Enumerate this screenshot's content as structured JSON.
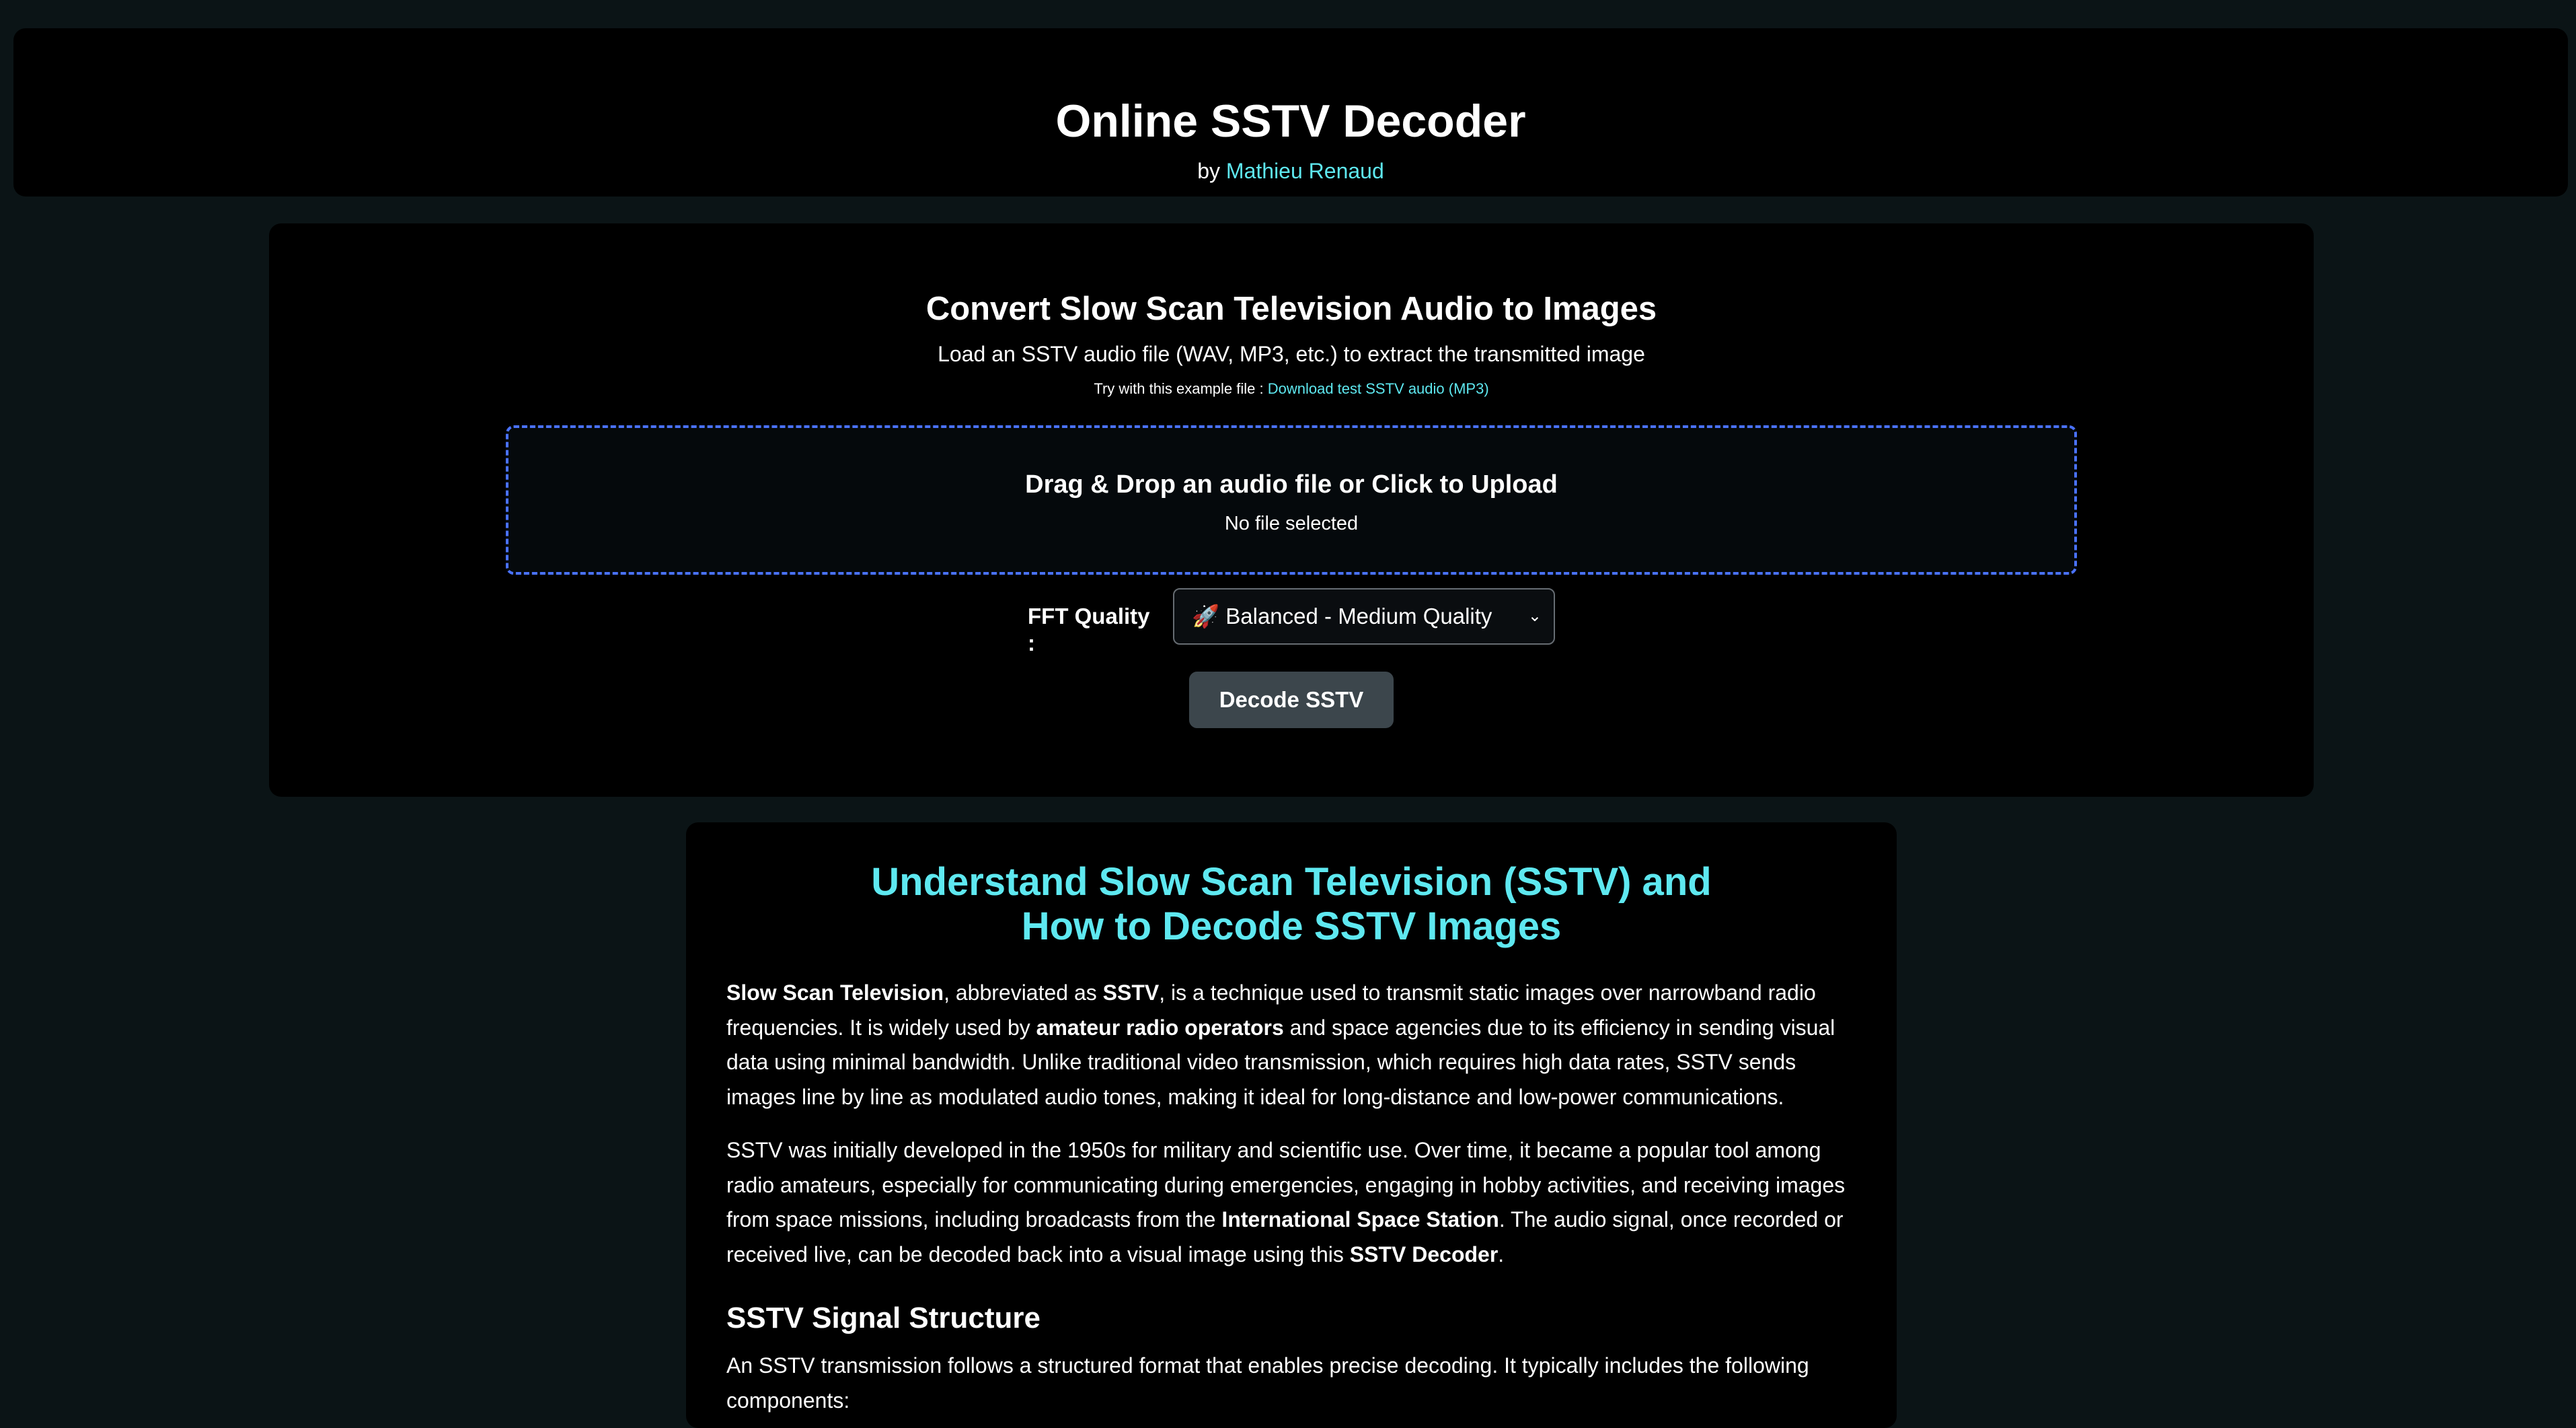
{
  "header": {
    "title": "Online SSTV Decoder",
    "by_prefix": "by",
    "author": "Mathieu Renaud"
  },
  "tool": {
    "heading": "Convert Slow Scan Television Audio to Images",
    "subheading": "Load an SSTV audio file (WAV, MP3, etc.) to extract the transmitted image",
    "example_prefix": "Try with this example file :",
    "example_link": "Download test SSTV audio (MP3)",
    "dropzone_title": "Drag & Drop an audio file or Click to Upload",
    "dropzone_status": "No file selected",
    "fft_label": "FFT Quality :",
    "fft_selected": "🚀 Balanced - Medium Quality",
    "decode_button": "Decode SSTV"
  },
  "article": {
    "heading_line1": "Understand Slow Scan Television (SSTV) and",
    "heading_line2": "How to Decode SSTV Images",
    "p1": {
      "b1": "Slow Scan Television",
      "t1": ", abbreviated as ",
      "b2": "SSTV",
      "t2": ", is a technique used to transmit static images over narrowband radio frequencies. It is widely used by ",
      "b3": "amateur radio operators",
      "t3": " and space agencies due to its efficiency in sending visual data using minimal bandwidth. Unlike traditional video transmission, which requires high data rates, SSTV sends images line by line as modulated audio tones, making it ideal for long-distance and low-power communications."
    },
    "p2": {
      "t1": "SSTV was initially developed in the 1950s for military and scientific use. Over time, it became a popular tool among radio amateurs, especially for communicating during emergencies, engaging in hobby activities, and receiving images from space missions, including broadcasts from the ",
      "b1": "International Space Station",
      "t2": ". The audio signal, once recorded or received live, can be decoded back into a visual image using this ",
      "b2": "SSTV Decoder",
      "t3": "."
    },
    "section_heading": "SSTV Signal Structure",
    "p3": "An SSTV transmission follows a structured format that enables precise decoding. It typically includes the following components:"
  },
  "colors": {
    "background": "#0b1416",
    "panel": "#000000",
    "accent": "#5ee8f0",
    "dropzone_border": "#4a72ff",
    "button": "#3c464c"
  }
}
